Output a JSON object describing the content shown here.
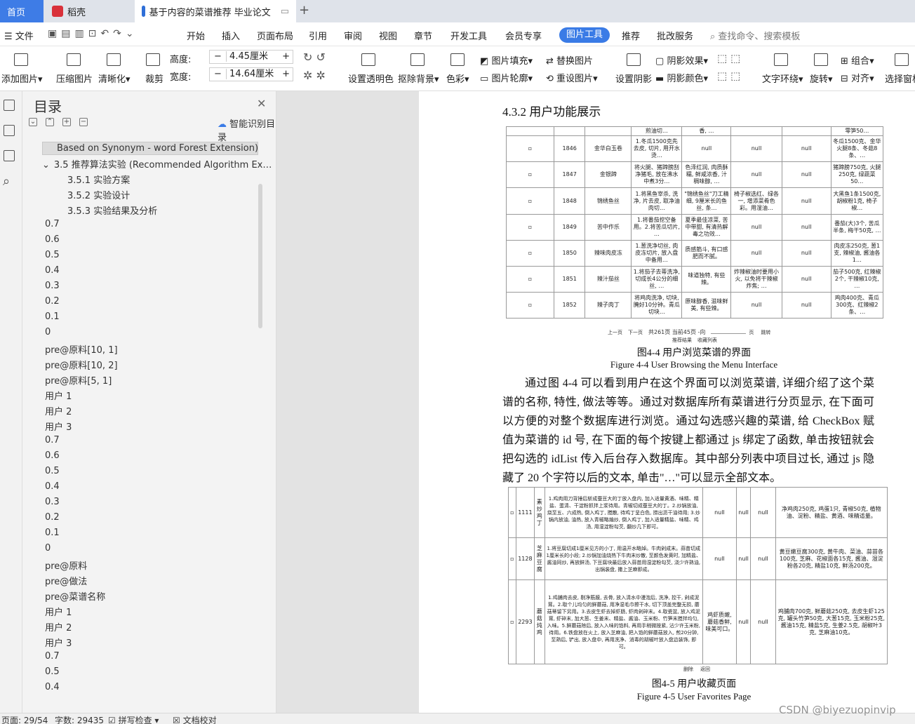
{
  "tabs": {
    "home": "首页",
    "daoke": "稻壳",
    "doc": "基于内容的菜谱推荐 毕业论文"
  },
  "menu": {
    "file": "文件",
    "items": [
      "开始",
      "插入",
      "页面布局",
      "引用",
      "审阅",
      "视图",
      "章节",
      "开发工具",
      "会员专享"
    ],
    "active": "图片工具",
    "items2": [
      "推荐",
      "批改服务"
    ],
    "search": "查找命令、搜索模板"
  },
  "ribbon": {
    "add_image": "添加图片",
    "compress": "压缩图片",
    "sharpen": "清晰化",
    "crop": "裁剪",
    "height_label": "高度:",
    "height_value": "4.45厘米",
    "width_label": "宽度:",
    "width_value": "14.64厘米",
    "transparent": "设置透明色",
    "remove_bg": "抠除背景",
    "color": "色彩",
    "fill": "图片填充",
    "outline": "图片轮廓",
    "replace": "替换图片",
    "reset": "重设图片",
    "shadow": "设置阴影",
    "shadow_effect": "阴影效果",
    "shadow_color": "阴影颜色",
    "wrap": "文字环绕",
    "rotate": "旋转",
    "group": "组合",
    "align": "对齐",
    "select_pane": "选择窗格"
  },
  "nav": {
    "title": "目录",
    "smart": "智能识别目录",
    "items": [
      {
        "label": "Based on Synonym - word Forest Extension)",
        "level": 1,
        "selected": true
      },
      {
        "label": "3.5 推荐算法实验 (Recommended Algorithm Ex…",
        "level": 1,
        "expander": "⌄"
      },
      {
        "label": "3.5.1 实验方案",
        "level": 2
      },
      {
        "label": "3.5.2 实验设计",
        "level": 2
      },
      {
        "label": "3.5.3 实验结果及分析",
        "level": 2
      },
      {
        "label": "0.7",
        "level": 0
      },
      {
        "label": "0.6",
        "level": 0
      },
      {
        "label": "0.5",
        "level": 0
      },
      {
        "label": "0.4",
        "level": 0
      },
      {
        "label": "0.3",
        "level": 0
      },
      {
        "label": "0.2",
        "level": 0
      },
      {
        "label": "0.1",
        "level": 0
      },
      {
        "label": "0",
        "level": 0
      },
      {
        "label": "pre@原料[10, 1]",
        "level": 0
      },
      {
        "label": "pre@原料[10, 2]",
        "level": 0
      },
      {
        "label": "pre@原料[5, 1]",
        "level": 0
      },
      {
        "label": "用户 1",
        "level": 0
      },
      {
        "label": "用户 2",
        "level": 0
      },
      {
        "label": "用户 3",
        "level": 0
      },
      {
        "label": "0.7",
        "level": 0
      },
      {
        "label": "0.6",
        "level": 0
      },
      {
        "label": "0.5",
        "level": 0
      },
      {
        "label": "0.4",
        "level": 0
      },
      {
        "label": "0.3",
        "level": 0
      },
      {
        "label": "0.2",
        "level": 0
      },
      {
        "label": "0.1",
        "level": 0
      },
      {
        "label": "0",
        "level": 0
      },
      {
        "label": "pre@原料",
        "level": 0
      },
      {
        "label": "pre@做法",
        "level": 0
      },
      {
        "label": "pre@菜谱名称",
        "level": 0
      },
      {
        "label": "用户 1",
        "level": 0
      },
      {
        "label": "用户 2",
        "level": 0
      },
      {
        "label": "用户 3",
        "level": 0
      },
      {
        "label": "0.7",
        "level": 0
      },
      {
        "label": "0.5",
        "level": 0
      },
      {
        "label": "0.4",
        "level": 0
      }
    ]
  },
  "doc": {
    "heading": "4.3.2  用户功能展示",
    "table1": {
      "top_cut": [
        "煎油切…",
        "香, …",
        "零笋50…"
      ],
      "rows": [
        {
          "id": "1846",
          "name": "金华白玉卷",
          "method": "1.冬瓜1500克先去皮, 切片, 用开水烫…",
          "feature": "null",
          "a": "null",
          "b": "null",
          "ingredients": "冬瓜1500克、金华火腿8条、冬菇8条、…"
        },
        {
          "id": "1847",
          "name": "金银蹄",
          "method": "将火腿、猪蹄膀刮净猪毛, 放在沸水中煮3分…",
          "feature": "色泽红润, 肉质酥糯, 鲜咸浓香, 汁稠味醇, …",
          "a": "null",
          "b": "null",
          "ingredients": "猪蹄膀750克, 火腿250克, 绿蔬菜50…"
        },
        {
          "id": "1848",
          "name": "锦绣鱼丝",
          "method": "1.将黑鱼宰杀, 洗净, 片去皮, 取净油肉切…",
          "feature": "\"锦绣鱼丝\"刀工精细, 9厘米长的鱼丝, 条…",
          "a": "椅子椒选红、绿各一, 增添菜肴色彩。用湿油…",
          "b": "null",
          "ingredients": "大黑鱼1条1500克, 胡椒粉1克, 椅子椒…"
        },
        {
          "id": "1849",
          "name": "苦中作乐",
          "method": "1.将番茄挖空备用。2.将苦瓜切片, …",
          "feature": "夏季最佳凉菜, 苦中带甜, 有清热解毒之功效…",
          "a": "null",
          "b": "null",
          "ingredients": "番茄(大)3个, 苦瓜半条, 梅干50克, …"
        },
        {
          "id": "1850",
          "name": "辣味肉皮冻",
          "method": "1.葱洗净切丝, 肉皮冻切片, 放入盘中备用…",
          "feature": "质感筋斗, 有口感肥而不腻。",
          "a": "null",
          "b": "null",
          "ingredients": "肉皮冻250克, 葱1支, 辣椒油, 酱油各1…"
        },
        {
          "id": "1851",
          "name": "辣汁茄丝",
          "method": "1.将茄子去蒂洗净, 切成长4公分的细丝, …",
          "feature": "味道独特, 有些辣。",
          "a": "炸辣椒油时要用小火, 以免将干辣椒炸焦; …",
          "b": "null",
          "ingredients": "茄子500克, 红辣椒2个, 干辣椒10克, …"
        },
        {
          "id": "1852",
          "name": "辣子肉丁",
          "method": "将鸡肉洗净, 切块, 腌好10分钟。青瓜切块…",
          "feature": "原味醇香, 滋味鲜美, 有些辣。",
          "a": "null",
          "b": "null",
          "ingredients": "鸡肉400克、青瓜300克、红辣椒2条、…"
        }
      ],
      "pager": {
        "prev": "上一页",
        "next": "下一页",
        "info": "共261页 当前45页 -向",
        "page_suffix": "页",
        "jump": "跳转",
        "btn1": "推荐结果",
        "btn2": "收藏列表"
      }
    },
    "caption1_cn": "图4-4  用户浏览菜谱的界面",
    "caption1_en": "Figure 4-4 User Browsing the Menu Interface",
    "paragraph": "通过图 4-4 可以看到用户在这个界面可以浏览菜谱, 详细介绍了这个菜谱的名称, 特性, 做法等等。通过对数据库所有菜谱进行分页显示, 在下面可以方便的对整个数据库进行浏览。通过勾选感兴趣的菜谱, 给 CheckBox 赋值为菜谱的 id 号, 在下面的每个按键上都通过 js 绑定了函数, 单击按钮就会把勾选的 idList 传入后台存入数据库。其中部分列表中项目过长, 通过 js 隐藏了 20 个字符以后的文本, 单击\"…\"可以显示全部文本。",
    "table2": {
      "rows": [
        {
          "id": "1111",
          "name": "素炒鸡丁",
          "method": "1.鸡肉用刀背捶后斩成蚕豆大的丁放入盘内, 加入适量黄酒、味精、精盐、蛋清、干淀粉抓拌上浆待用。青椒切成蚕豆大的丁。2.炒锅放油, 烧至五、六成热, 倒入鸡丁, 搅散, 待鸡丁呈白色, 捞出沥干油待用; 3.炒锅内放油, 油热, 放入青椒略煸炒, 倒入鸡丁, 加入适量精盐、味精、鸡汤, 用湿淀粉勾芡, 翻炒几下即可。",
          "feature": "null",
          "a": "null",
          "b": "null",
          "ingredients": "净鸡肉250克, 鸡蛋1只, 青椒50克, 植物油、淀粉、精盐、黄酒、味精适量。"
        },
        {
          "id": "1128",
          "name": "芝麻豆腐",
          "method": "1.将豆腐切成1厘米见方的小丁, 用温开水略焯。牛肉剁成末。蒜苗切成1厘米长的小段; 2.炒锅加油烧热下牛肉末炒散, 至颜色发黄时, 加精盐、酱油同炒, 再放鲜汤, 下豆腐块最后放入蒜苗用湿淀粉勾芡, 浇少许熟油, 出锅装盘, 撒上芝麻即成。",
          "feature": "null",
          "a": "null",
          "b": "null",
          "ingredients": "黄豆嫩豆腐300克, 黄牛肉、菜油、蒜苗各100克, 芝麻、花椒面各15克, 酱油、湿淀粉各20克, 精盐10克, 鲜汤200克。"
        },
        {
          "id": "2293",
          "name": "蘑菇炖鸡",
          "method": "1.鸡脯肉去皮, 剔净筋膜, 去骨, 放入清水中漫泡后, 洗净, 控干, 剁成泥茸。2.取个儿均匀的鲜蘑菇, 用净湿毛巾擦干水, 切下顶盖完整无损, 蘑菇蒂留下另用。3.去皮生虾去掉虾肠, 虾肉剁碎末。4.取瓷盆, 放入鸡泥茸, 虾碎末, 加大葱、生姜末、精盐、酱油、玉米粉、竹笋末搅拌均匀, 入味。5.鲜蘑菇除后, 放入入味的馅料, 再用手稍微按紧, 沾少许玉米粉, 待用。6.铁盘放在火上, 放入芝麻油, 把入馅的鲜蘑菇放入, 煎20分钟, 至熟后, 铲出, 放入盘中, 再用洗净、消毒的胡椒叶放入盘边装饰, 即可。",
          "feature": "鸡虾质嫩, 蘑菇香鲜, 味美可口。",
          "a": "null",
          "b": "null",
          "ingredients": "鸡脯肉700克, 鲜蘑菇250克, 去皮生虾125克, 罐头竹笋50克, 大葱15克, 玉米粉25克, 酱油15克, 精盐5克, 生姜2.5克, 胡椒叶3克, 芝麻油10克。"
        }
      ],
      "btn1": "删除",
      "btn2": "返回"
    },
    "caption2_cn": "图4-5  用户收藏页面",
    "caption2_en": "Figure 4-5 User Favorites Page"
  },
  "status": {
    "page": "页面: 29/54",
    "words": "字数: 29435",
    "spell": "拼写检查",
    "proof": "文档校对"
  },
  "watermark": "CSDN @biyezuopinvip",
  "colors": {
    "accent": "#3a7be6",
    "tab_home": "#3e7ce6"
  }
}
